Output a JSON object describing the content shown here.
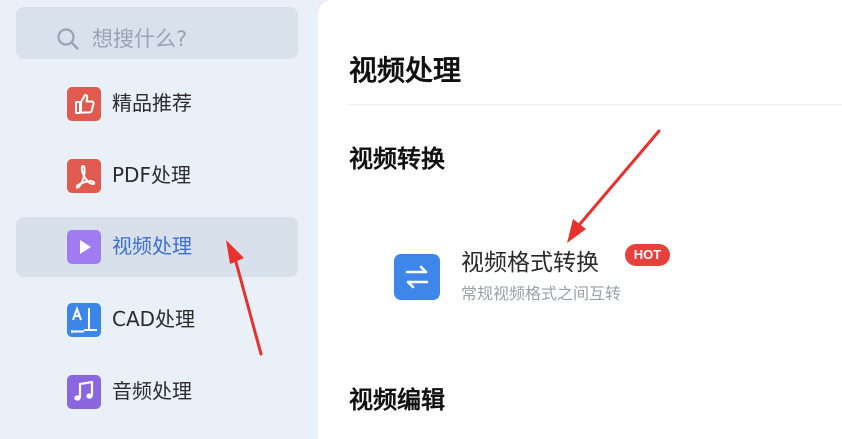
{
  "search": {
    "placeholder": "想搜什么?"
  },
  "sidebar": {
    "items": [
      {
        "label": "精品推荐",
        "icon": "thumbs-up-icon",
        "color": "#e05a4f",
        "active": false
      },
      {
        "label": "PDF处理",
        "icon": "pdf-icon",
        "color": "#e05a4f",
        "active": false
      },
      {
        "label": "视频处理",
        "icon": "play-icon",
        "color": "#9b6ff0",
        "active": true
      },
      {
        "label": "CAD处理",
        "icon": "cad-icon",
        "color": "#3b86e6",
        "active": false
      },
      {
        "label": "音频处理",
        "icon": "music-note-icon",
        "color": "#8c66e0",
        "active": false
      }
    ]
  },
  "main": {
    "title": "视频处理",
    "sections": [
      {
        "title": "视频转换",
        "tools": [
          {
            "name": "视频格式转换",
            "badge": "HOT",
            "desc": "常规视频格式之间互转",
            "icon": "swap-arrows-icon",
            "color": "#3f86ea"
          }
        ]
      },
      {
        "title": "视频编辑"
      }
    ]
  },
  "annotation_color": "#e8302c"
}
